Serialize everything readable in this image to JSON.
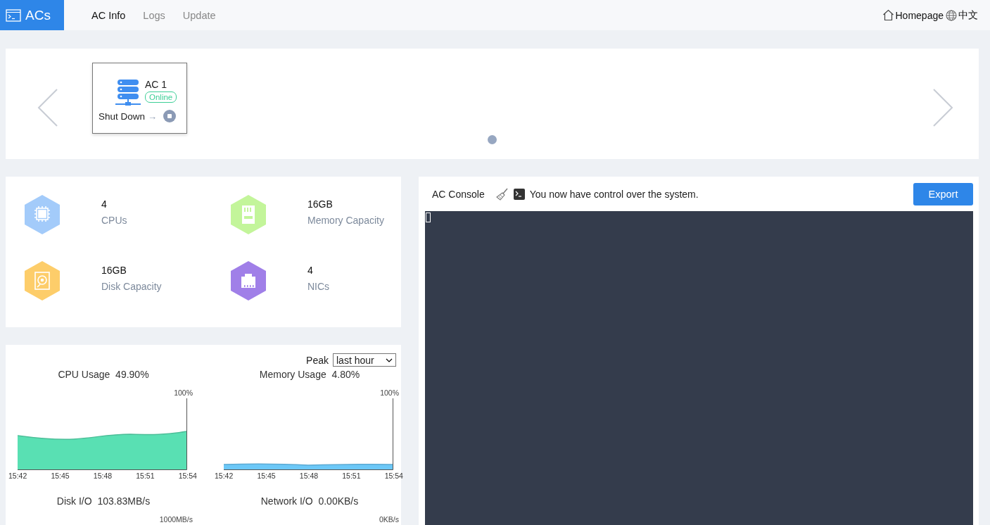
{
  "header": {
    "logo": "ACs",
    "nav": [
      {
        "label": "AC Info",
        "selected": true
      },
      {
        "label": "Logs",
        "selected": false
      },
      {
        "label": "Update",
        "selected": false
      }
    ],
    "homepage": "Homepage",
    "language": "中文"
  },
  "carousel": {
    "devices": [
      {
        "name": "AC 1",
        "status": "Online",
        "online": true,
        "action": "Shut Down",
        "arrow": "→"
      }
    ],
    "dots": [
      {
        "selected": true
      }
    ]
  },
  "stats": [
    {
      "kind": "cpu",
      "value": "4",
      "label": "CPUs",
      "color": "#a3cbfa"
    },
    {
      "kind": "memory",
      "value": "16GB",
      "label": "Memory Capacity",
      "color": "#c3f59a"
    },
    {
      "kind": "disk",
      "value": "16GB",
      "label": "Disk Capacity",
      "color": "#fdcd6a"
    },
    {
      "kind": "nic",
      "value": "4",
      "label": "NICs",
      "color": "#a07fe8"
    }
  ],
  "monitor": {
    "peak_label": "Peak",
    "peak_value": "last hour",
    "charts": [
      {
        "kind": "high",
        "title": "CPU Usage",
        "reading": "49.90%",
        "max_label": "100%",
        "color": "#59e0b3",
        "xticks": [
          "15:42",
          "15:45",
          "15:48",
          "15:51",
          "15:54"
        ]
      },
      {
        "kind": "low",
        "title": "Memory Usage",
        "reading": "4.80%",
        "max_label": "100%",
        "color": "#6cc8f8",
        "xticks": [
          "15:42",
          "15:45",
          "15:48",
          "15:51",
          "15:54"
        ]
      },
      {
        "kind": "none",
        "title": "Disk I/O",
        "reading": "103.83MB/s",
        "max_label": "1000MB/s"
      },
      {
        "kind": "none",
        "title": "Network I/O",
        "reading": "0.00KB/s",
        "max_label": "0KB/s"
      }
    ]
  },
  "console": {
    "title": "AC Console",
    "message": "You now have control over the system.",
    "export": "Export"
  }
}
